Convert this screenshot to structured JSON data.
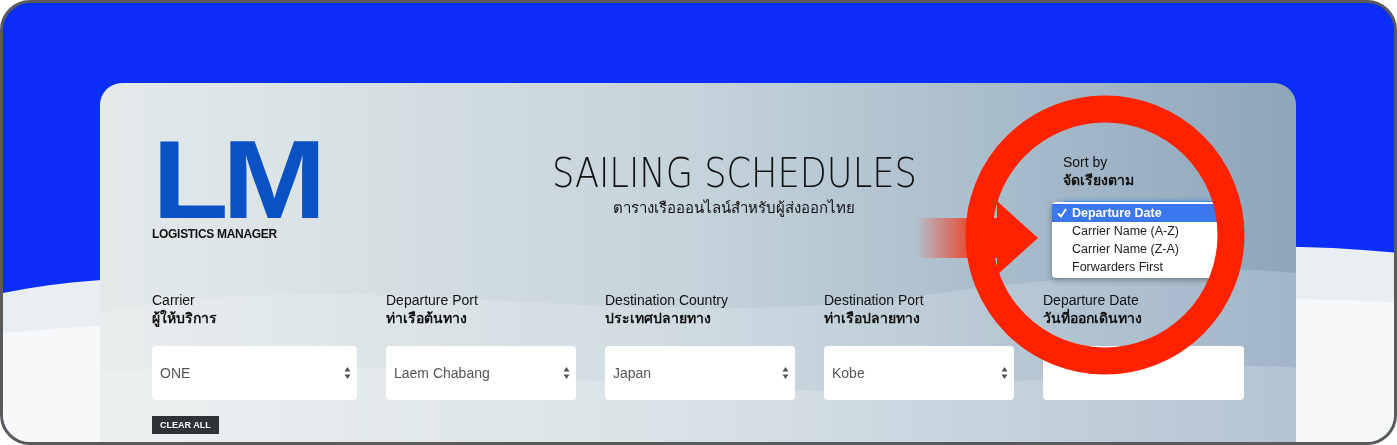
{
  "logo": {
    "mark": "LM",
    "tagline": "LOGISTICS MANAGER"
  },
  "title": "SAILING SCHEDULES",
  "subtitle": "ตารางเรือออนไลน์สำหรับผู้ส่งออกไทย",
  "sort": {
    "label": "Sort by",
    "label_th": "จัดเรียงตาม",
    "options": [
      {
        "label": "Departure Date",
        "selected": true
      },
      {
        "label": "Carrier Name (A-Z)",
        "selected": false
      },
      {
        "label": "Carrier Name (Z-A)",
        "selected": false
      },
      {
        "label": "Forwarders First",
        "selected": false
      }
    ]
  },
  "filters": [
    {
      "kind": "select",
      "label": "Carrier",
      "label_th": "ผู้ให้บริการ",
      "value": "ONE"
    },
    {
      "kind": "select",
      "label": "Departure Port",
      "label_th": "ท่าเรือต้นทาง",
      "value": "Laem Chabang"
    },
    {
      "kind": "select",
      "label": "Destination Country",
      "label_th": "ประเทศปลายทาง",
      "value": "Japan"
    },
    {
      "kind": "select",
      "label": "Destination Port",
      "label_th": "ท่าเรือปลายทาง",
      "value": "Kobe"
    },
    {
      "kind": "date",
      "label": "Departure Date",
      "label_th": "วันที่ออกเดินทาง"
    }
  ],
  "clear_button": "CLEAR ALL"
}
